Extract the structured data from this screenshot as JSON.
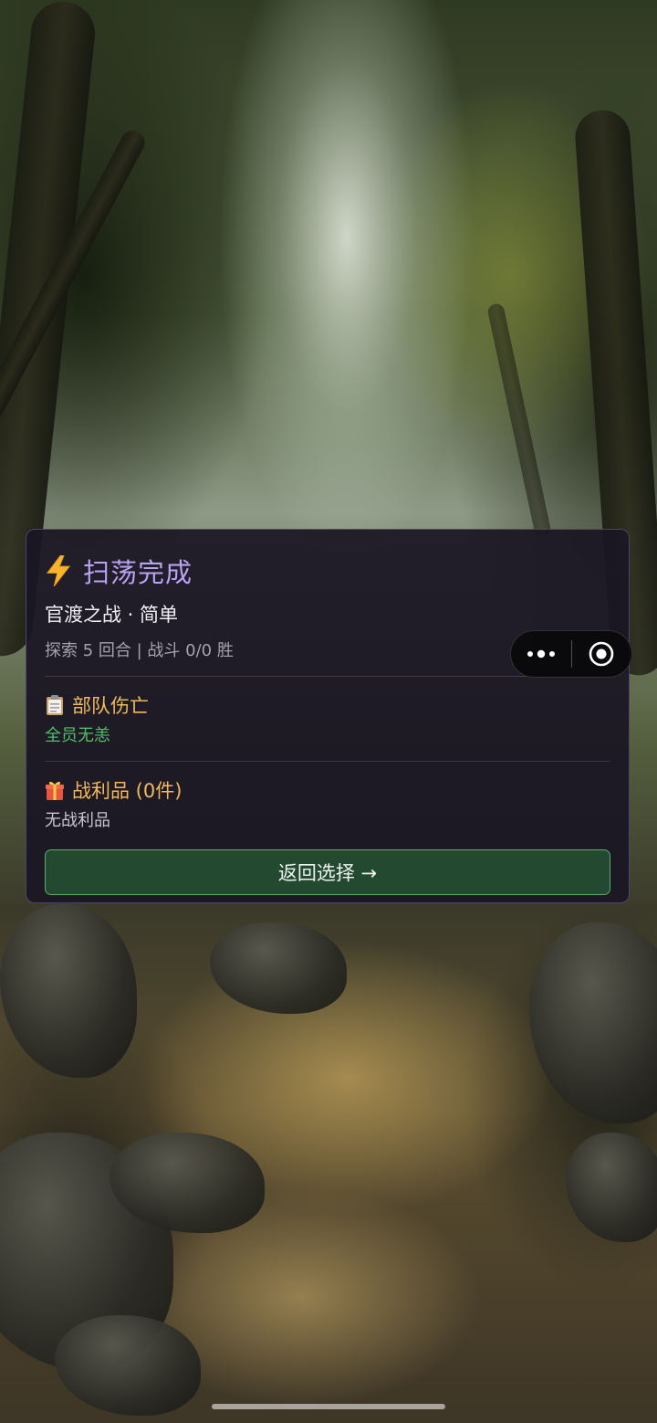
{
  "result": {
    "title": "扫荡完成",
    "subtitle": "官渡之战 · 简单",
    "stats": "探索 5 回合 | 战斗 0/0 胜",
    "casualties": {
      "label": "部队伤亡",
      "value": "全员无恙",
      "icon": "clipboard-icon"
    },
    "loot": {
      "label": "战利品 (0件)",
      "value": "无战利品",
      "icon": "gift-icon"
    },
    "return_button": "返回选择 →"
  },
  "capsule": {
    "more_icon": "more-dots-icon",
    "close_icon": "target-close-icon"
  },
  "colors": {
    "title": "#b9a2f2",
    "section_label": "#f1b95a",
    "success": "#4fbf6a",
    "button_bg": "#234a30",
    "button_border": "#5fa86e"
  }
}
